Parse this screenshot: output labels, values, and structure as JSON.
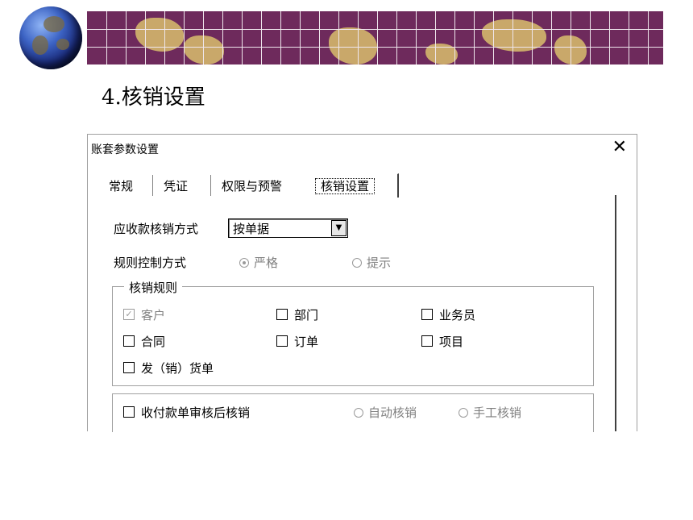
{
  "slide": {
    "title": "4.核销设置"
  },
  "dialog": {
    "title": "账套参数设置",
    "close_icon": "close-icon",
    "tabs": [
      {
        "label": "常规"
      },
      {
        "label": "凭证"
      },
      {
        "label": "权限与预警"
      },
      {
        "label": "核销设置",
        "active": true
      }
    ],
    "receivable_method": {
      "label": "应收款核销方式",
      "value": "按单据"
    },
    "rule_control": {
      "label": "规则控制方式",
      "options": [
        {
          "label": "严格",
          "selected": true
        },
        {
          "label": "提示",
          "selected": false
        }
      ]
    },
    "writeoff_rules": {
      "legend": "核销规则",
      "items": [
        {
          "label": "客户",
          "checked": true,
          "disabled": true
        },
        {
          "label": "部门",
          "checked": false
        },
        {
          "label": "业务员",
          "checked": false
        },
        {
          "label": "合同",
          "checked": false
        },
        {
          "label": "订单",
          "checked": false
        },
        {
          "label": "项目",
          "checked": false
        },
        {
          "label": "发（销）货单",
          "checked": false
        }
      ]
    },
    "receipt_audit": {
      "label": "收付款单审核后核销",
      "checked": false,
      "options": [
        {
          "label": "自动核销",
          "selected": false
        },
        {
          "label": "手工核销",
          "selected": false
        }
      ]
    }
  }
}
